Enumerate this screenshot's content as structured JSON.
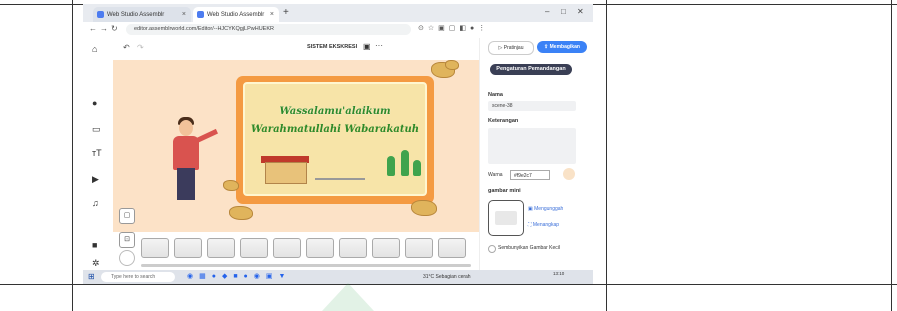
{
  "browser": {
    "tabs": [
      {
        "label": "Web Studio Assemblr"
      },
      {
        "label": "Web Studio Assemblr"
      }
    ],
    "new_tab": "+",
    "window_controls": [
      "–",
      "□",
      "✕"
    ],
    "url": "editor.assemblrworld.com/Editor/--HJCYKQgjLPwHUEKR"
  },
  "editor": {
    "title": "SISTEM EKSKRESI",
    "slide_text_1": "Wassalamu'alaikum",
    "slide_text_2": "Warahmatullahi Wabarakatuh"
  },
  "right_panel": {
    "preview_label": "Pratinjau",
    "share_label": "Membagikan",
    "view_settings_label": "Pengaturan Pemandangan",
    "name_label": "Nama",
    "name_value": "scene-38",
    "description_label": "Keterangan",
    "color_label": "Warna",
    "color_value": "#f9e2c7",
    "thumbnail_label": "gambar mini",
    "upload_label": "Mengunggah",
    "capture_label": "Menangkap",
    "hide_thumbnail_label": "Sembunyikan Gambar Kecil"
  },
  "taskbar": {
    "search_placeholder": "Type here to search",
    "weather": "31°C  Sebagian cerah",
    "time": "13:10"
  },
  "colors": {
    "canvas_bg": "#fce2c7",
    "board_frame": "#f49a42",
    "accent_blue": "#3b82f6",
    "dark_button": "#3a3f55",
    "greeting_green": "#2e8a2a"
  }
}
